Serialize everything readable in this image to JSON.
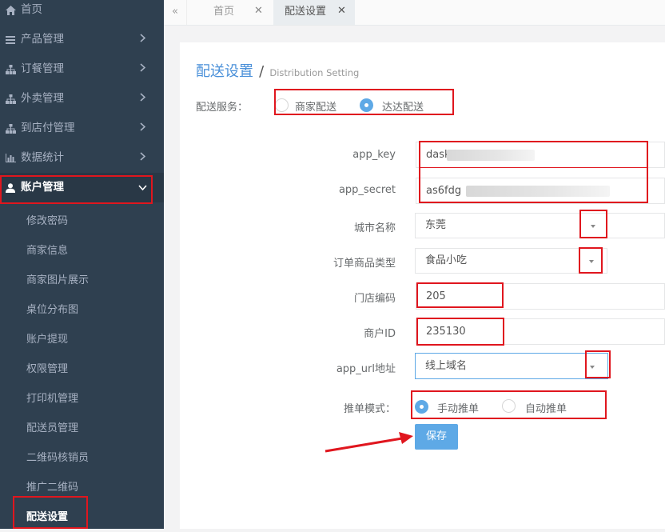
{
  "sidebar": {
    "items": [
      {
        "label": "首页",
        "icon": "home-icon"
      },
      {
        "label": "产品管理",
        "icon": "list-icon"
      },
      {
        "label": "订餐管理",
        "icon": "sitemap-icon"
      },
      {
        "label": "外卖管理",
        "icon": "sitemap-icon"
      },
      {
        "label": "到店付管理",
        "icon": "sitemap-icon"
      },
      {
        "label": "数据统计",
        "icon": "bar-chart-icon"
      },
      {
        "label": "账户管理",
        "icon": "user-icon"
      }
    ],
    "sub_items": [
      "修改密码",
      "商家信息",
      "商家图片展示",
      "桌位分布图",
      "账户提现",
      "权限管理",
      "打印机管理",
      "配送员管理",
      "二维码核销员",
      "推广二维码",
      "配送设置"
    ]
  },
  "tabs": {
    "back_glyph": "«",
    "items": [
      {
        "label": "首页",
        "close": "✕"
      },
      {
        "label": "配送设置",
        "close": "✕"
      }
    ]
  },
  "page": {
    "title": "配送设置",
    "separator": "/",
    "subtitle": "Distribution Setting"
  },
  "form": {
    "service_label": "配送服务：",
    "service_options": [
      "商家配送",
      "达达配送"
    ],
    "service_selected": "达达配送",
    "app_key_label": "app_key",
    "app_key_value": "dask",
    "app_secret_label": "app_secret",
    "app_secret_value": "as6fdg",
    "city_label": "城市名称",
    "city_value": "东莞",
    "goods_type_label": "订单商品类型",
    "goods_type_value": "食品小吃",
    "store_code_label": "门店编码",
    "store_code_value": "205",
    "merchant_id_label": "商户ID",
    "merchant_id_value": "235130",
    "app_url_label": "app_url地址",
    "app_url_value": "线上域名",
    "push_mode_label": "推单模式：",
    "push_options": [
      "手动推单",
      "自动推单"
    ],
    "push_selected": "手动推单",
    "save_label": "保存"
  },
  "colors": {
    "sidebar_bg": "#2f4050",
    "accent": "#5ea9e6",
    "annotation": "#e0161e"
  }
}
